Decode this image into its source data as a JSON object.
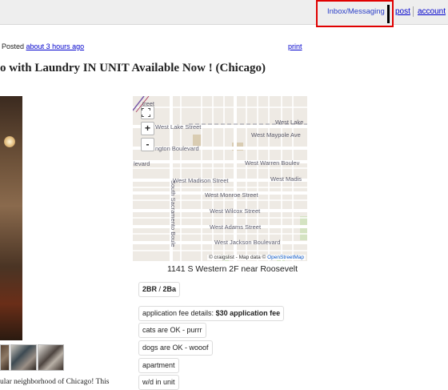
{
  "header": {
    "inbox_label": "Inbox/Messaging",
    "post_label": "post",
    "account_label": "account"
  },
  "posting": {
    "posted_prefix": "Posted",
    "posted_time": "about 3 hours ago",
    "print_label": "print",
    "title": "o with Laundry IN UNIT Available Now ! (Chicago)",
    "body_snippet": "ular neighborhood of Chicago! This"
  },
  "map": {
    "zoom_in": "+",
    "zoom_out": "-",
    "streets": {
      "top": "treet",
      "lake_w": "West Lake Street",
      "lake_e": "West Lake",
      "maypole": "West Maypole Ave",
      "washington": "ngton Boulevard",
      "warren_w": "levard",
      "warren": "West Warren Boulev",
      "madison": "West Madison Street",
      "madison_e": "West Madis",
      "monroe": "West Monroe Street",
      "wilcox": "West Wilcox Street",
      "adams": "West Adams Street",
      "jackson": "West Jackson Boulevard",
      "sacramento": "South Sacramento Boule"
    },
    "attribution_prefix": "© craigslist - Map data ©",
    "attribution_link": "OpenStreetMap",
    "address": "1141 S Western 2F near Roosevelt"
  },
  "attributes": {
    "bedrooms": "2BR",
    "bathrooms": "2Ba",
    "fee_label": "application fee details:",
    "fee_value": "$30 application fee",
    "cats": "cats are OK - purrr",
    "dogs": "dogs are OK - wooof",
    "housing_type": "apartment",
    "laundry": "w/d in unit"
  },
  "colors": {
    "link": "#0000cc",
    "highlight_box": "#e00000",
    "map_bg": "#eeeae4"
  }
}
